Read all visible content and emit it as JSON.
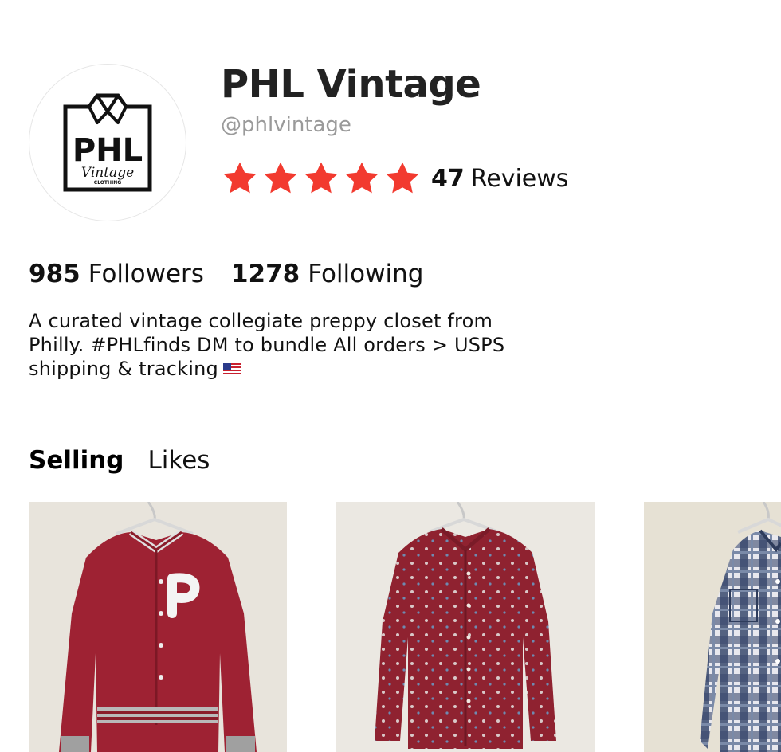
{
  "profile": {
    "name": "PHL Vintage",
    "handle": "@phlvintage",
    "logo_text": "PHL",
    "logo_script": "Vintage",
    "logo_sub": "CLOTHING",
    "rating_stars": 5,
    "review_count": "47",
    "review_label": "Reviews",
    "star_color": "#f23a2f"
  },
  "stats": {
    "followers_count": "985",
    "followers_label": "Followers",
    "following_count": "1278",
    "following_label": "Following"
  },
  "bio": {
    "text": "A curated vintage collegiate preppy closet from Philly. #PHLfinds DM to bundle All orders > USPS shipping & tracking",
    "flag_icon": "us-flag-icon"
  },
  "tabs": {
    "selling": "Selling",
    "likes": "Likes"
  },
  "products": [
    {
      "name": "maroon-satin-phillies-jacket",
      "color": "#9e2233"
    },
    {
      "name": "red-patterned-button-shirt",
      "color": "#8f2230"
    },
    {
      "name": "blue-plaid-western-shirt",
      "color": "#3a4a6e"
    }
  ]
}
